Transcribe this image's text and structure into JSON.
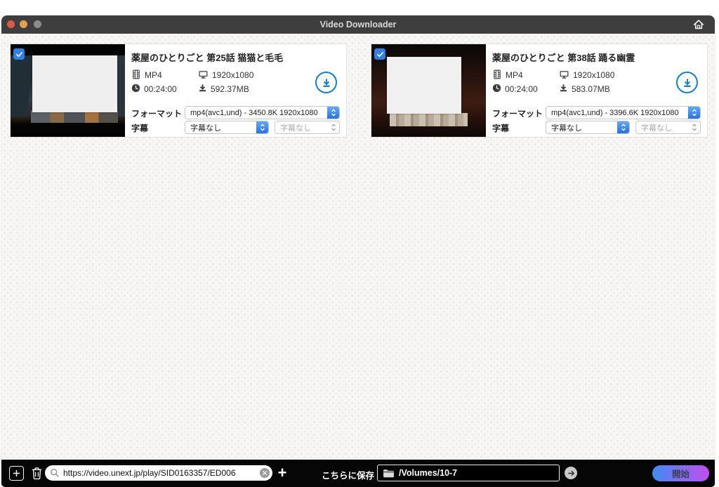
{
  "titlebar": {
    "title": "Video Downloader"
  },
  "labels": {
    "format": "フォーマット",
    "subtitle": "字幕",
    "save_to": "こちらに保存"
  },
  "cards": [
    {
      "title": "薬屋のひとりごと 第25話 猫猫と毛毛",
      "container": "MP4",
      "resolution": "1920x1080",
      "duration": "00:24:00",
      "filesize": "592.37MB",
      "format_option": "mp4(avc1,und) - 3450.8K 1920x1080",
      "subtitle_option": "字幕なし",
      "subtitle_option_2": "字幕なし"
    },
    {
      "title": "薬屋のひとりごと 第38話 踊る幽霊",
      "container": "MP4",
      "resolution": "1920x1080",
      "duration": "00:24:00",
      "filesize": "583.07MB",
      "format_option": "mp4(avc1,und) - 3396.6K 1920x1080",
      "subtitle_option": "字幕なし",
      "subtitle_option_2": "字幕なし"
    }
  ],
  "toolbar": {
    "url_value": "https://video.unext.jp/play/SID0163357/ED006",
    "path_value": "/Volumes/10-7",
    "start_label": "開始"
  },
  "colors": {
    "accent_blue": "#1480d1",
    "stepper_blue": "#2374e2",
    "checkbox_blue": "#2f81ea",
    "start_gradient_from": "#3f8cf3",
    "start_gradient_to": "#c44df0",
    "titlebar_bg": "#3e3e3e",
    "bottombar_bg": "#060606"
  }
}
